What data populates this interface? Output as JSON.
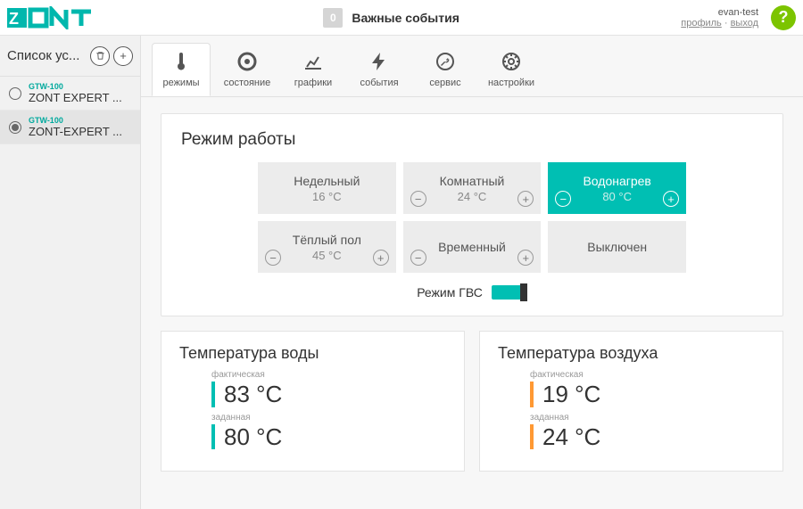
{
  "header": {
    "events_count": "0",
    "events_label": "Важные события",
    "user": "evan-test",
    "profile_link": "профиль",
    "logout_link": "выход",
    "help": "?"
  },
  "sidebar": {
    "title": "Список ус...",
    "devices": [
      {
        "model": "GTW-100",
        "name": "ZONT EXPERT ..."
      },
      {
        "model": "GTW-100",
        "name": "ZONT-EXPERT ..."
      }
    ]
  },
  "tabs": [
    {
      "id": "modes",
      "label": "режимы"
    },
    {
      "id": "status",
      "label": "состояние"
    },
    {
      "id": "charts",
      "label": "графики"
    },
    {
      "id": "events",
      "label": "события"
    },
    {
      "id": "service",
      "label": "сервис"
    },
    {
      "id": "settings",
      "label": "настройки"
    }
  ],
  "mode_card": {
    "title": "Режим работы",
    "tiles": [
      {
        "name": "Недельный",
        "temp": "16 °C",
        "adjustable": true,
        "active": false
      },
      {
        "name": "Комнатный",
        "temp": "24 °C",
        "adjustable": true,
        "active": false
      },
      {
        "name": "Водонагрев",
        "temp": "80 °C",
        "adjustable": true,
        "active": true
      },
      {
        "name": "Тёплый пол",
        "temp": "45 °C",
        "adjustable": true,
        "active": false
      },
      {
        "name": "Временный",
        "temp": "",
        "adjustable": true,
        "active": false
      },
      {
        "name": "Выключен",
        "temp": "",
        "adjustable": false,
        "active": false
      }
    ],
    "gvs_label": "Режим ГВС"
  },
  "temp_water": {
    "title": "Температура воды",
    "actual_label": "фактическая",
    "actual_value": "83 °C",
    "target_label": "заданная",
    "target_value": "80 °C"
  },
  "temp_air": {
    "title": "Температура воздуха",
    "actual_label": "фактическая",
    "actual_value": "19 °C",
    "target_label": "заданная",
    "target_value": "24 °C"
  }
}
